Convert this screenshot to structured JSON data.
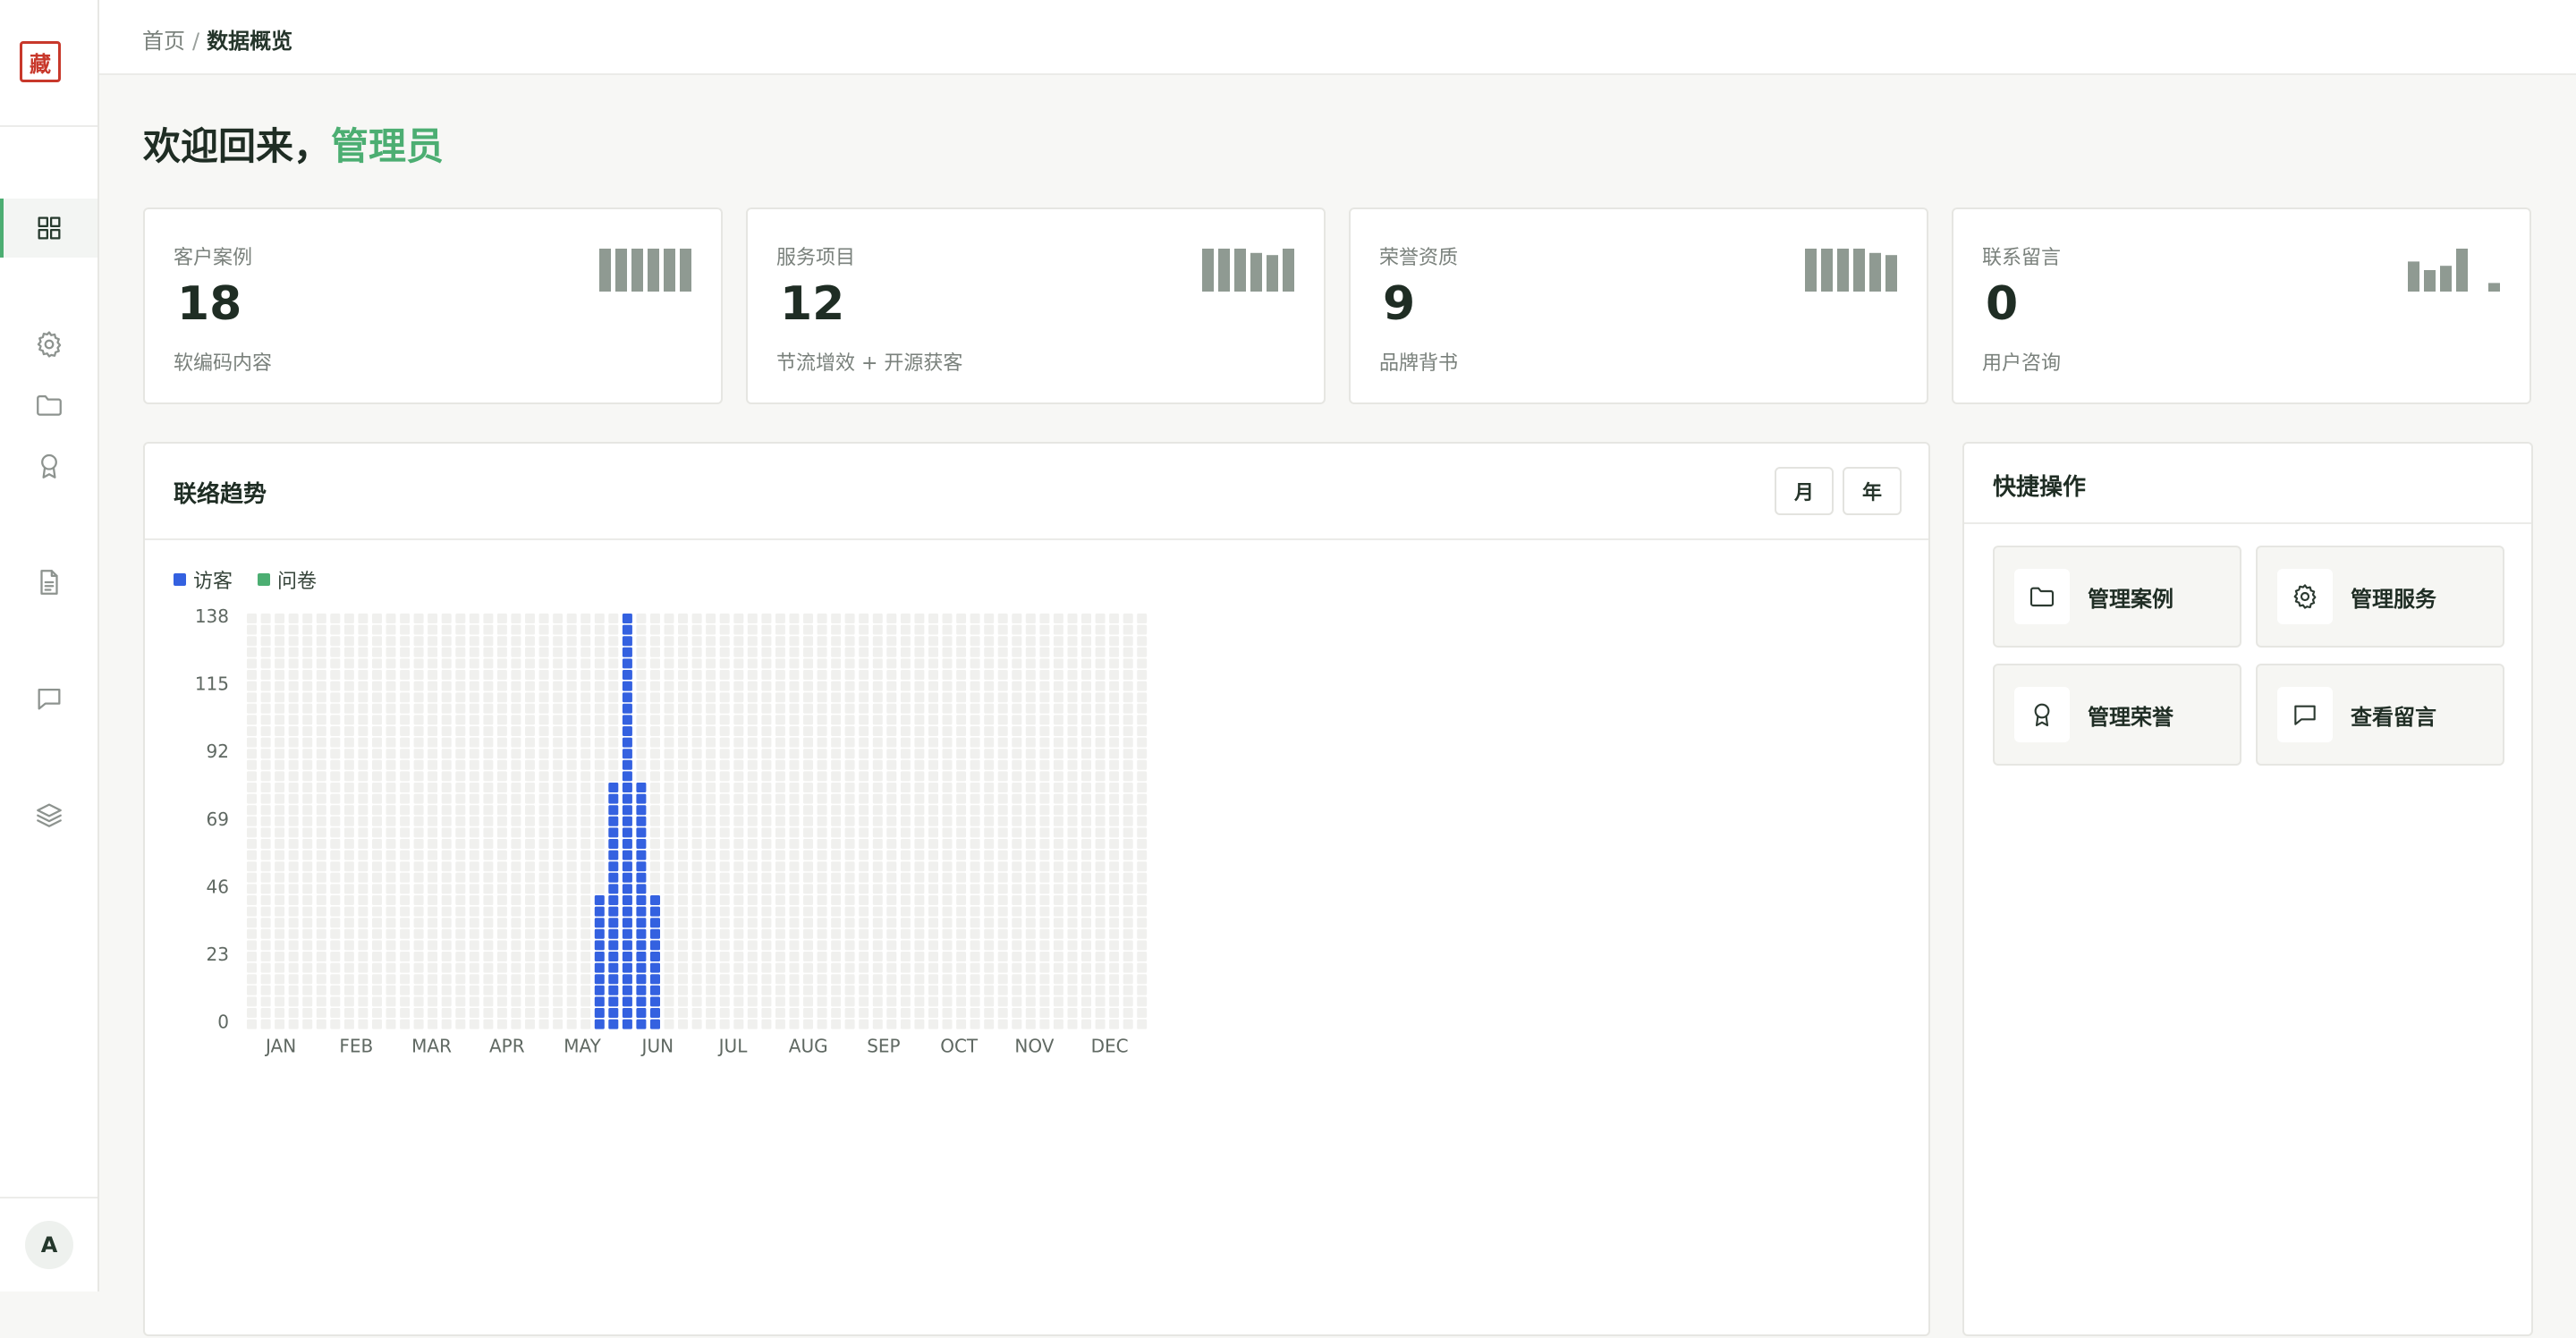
{
  "sidebar": {
    "logo_text": "藏",
    "avatar": "A",
    "icons": [
      "dashboard-icon",
      "gear-icon",
      "folder-icon",
      "award-icon",
      "document-icon",
      "message-icon",
      "layers-icon"
    ]
  },
  "breadcrumb": {
    "home": "首页",
    "separator": "/",
    "current": "数据概览"
  },
  "welcome": {
    "prefix": "欢迎回来，",
    "name": "管理员"
  },
  "stats": [
    {
      "label": "客户案例",
      "value": "18",
      "sub": "软编码内容",
      "spark": [
        1,
        1,
        1,
        1,
        1,
        1
      ]
    },
    {
      "label": "服务项目",
      "value": "12",
      "sub": "节流增效 + 开源获客",
      "spark": [
        1,
        1,
        1,
        0.9,
        0.85,
        1
      ]
    },
    {
      "label": "荣誉资质",
      "value": "9",
      "sub": "品牌背书",
      "spark": [
        1,
        1,
        1,
        1,
        0.9,
        0.85
      ]
    },
    {
      "label": "联系留言",
      "value": "0",
      "sub": "用户咨询",
      "spark": [
        0.7,
        0.5,
        0.6,
        1,
        0,
        0.2
      ]
    }
  ],
  "trend": {
    "title": "联络趋势",
    "buttons": {
      "month": "月",
      "year": "年"
    },
    "legend": {
      "visitors": "访客",
      "survey": "问卷"
    }
  },
  "colors": {
    "accent": "#4cae72",
    "visitors": "#3461e0",
    "survey": "#4cae72",
    "empty_cell": "#f0f0ee"
  },
  "chart_data": {
    "type": "bar",
    "style": "dot-matrix",
    "y_ticks": [
      "138",
      "115",
      "92",
      "69",
      "46",
      "23",
      "0"
    ],
    "ylim": [
      0,
      138
    ],
    "categories": [
      "JAN",
      "FEB",
      "MAR",
      "APR",
      "MAY",
      "JUN",
      "JUL",
      "AUG",
      "SEP",
      "OCT",
      "NOV",
      "DEC"
    ],
    "series": [
      {
        "name": "访客",
        "values": [
          0,
          0,
          0,
          0,
          0,
          138,
          0,
          0,
          0,
          0,
          0,
          0
        ]
      },
      {
        "name": "问卷",
        "values": [
          0,
          0,
          0,
          0,
          0,
          0,
          0,
          0,
          0,
          0,
          0,
          0
        ]
      }
    ],
    "daily_bars_around_jun": [
      {
        "day_col": 25,
        "value": 41
      },
      {
        "day_col": 26,
        "value": 81
      },
      {
        "day_col": 27,
        "value": 138
      },
      {
        "day_col": 28,
        "value": 81
      },
      {
        "day_col": 29,
        "value": 41
      }
    ],
    "grid": true,
    "legend_position": "top-left"
  },
  "quick": {
    "title": "快捷操作",
    "actions": [
      {
        "label": "管理案例",
        "icon": "folder-icon"
      },
      {
        "label": "管理服务",
        "icon": "gear-icon"
      },
      {
        "label": "管理荣誉",
        "icon": "award-icon"
      },
      {
        "label": "查看留言",
        "icon": "message-icon"
      }
    ]
  }
}
